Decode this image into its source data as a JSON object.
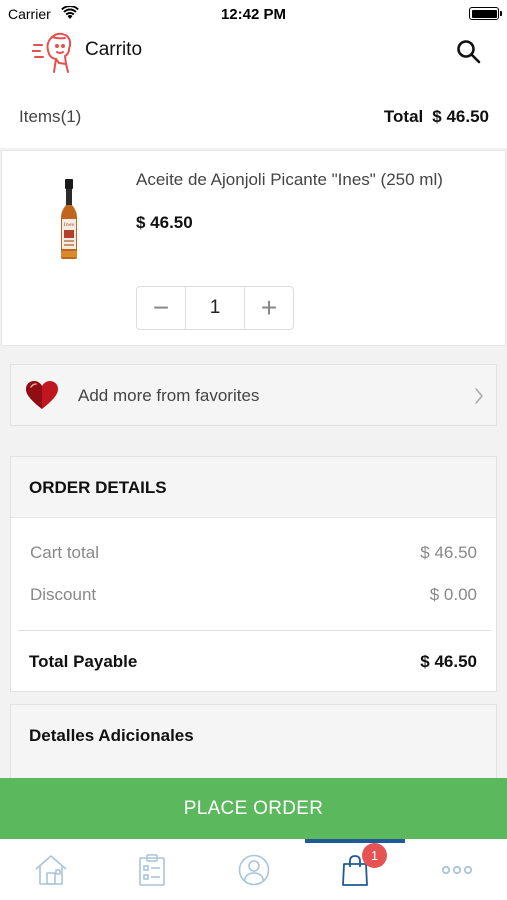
{
  "status_bar": {
    "carrier": "Carrier",
    "time": "12:42 PM"
  },
  "header": {
    "title": "Carrito",
    "logo_icon": "delivery-person-icon",
    "search_icon": "search-icon"
  },
  "summary": {
    "items_label": "Items",
    "items_count": "(1)",
    "total_label": "Total",
    "total_value": "$ 46.50"
  },
  "cart_items": [
    {
      "name": "Aceite de Ajonjoli Picante \"Ines\" (250 ml)",
      "price": "$ 46.50",
      "quantity": "1",
      "minus": "−",
      "plus": "+"
    }
  ],
  "favorites": {
    "label": "Add more from favorites"
  },
  "order_details": {
    "title": "ORDER DETAILS",
    "cart_total_label": "Cart total",
    "cart_total_value": "$ 46.50",
    "discount_label": "Discount",
    "discount_value": "$ 0.00",
    "payable_label": "Total Payable",
    "payable_value": "$ 46.50"
  },
  "additional": {
    "title": "Detalles Adicionales"
  },
  "place_order": {
    "label": "PLACE ORDER"
  },
  "tabs": [
    {
      "icon": "home-icon"
    },
    {
      "icon": "orders-list-icon"
    },
    {
      "icon": "profile-icon"
    },
    {
      "icon": "shopping-bag-icon",
      "active": true,
      "badge": "1"
    },
    {
      "icon": "more-icon"
    }
  ],
  "colors": {
    "accent": "#5cb85c",
    "tab_active": "#1e5a99",
    "tab_inactive": "#a9c4dc",
    "badge": "#e55353",
    "logo": "#e8504f"
  }
}
